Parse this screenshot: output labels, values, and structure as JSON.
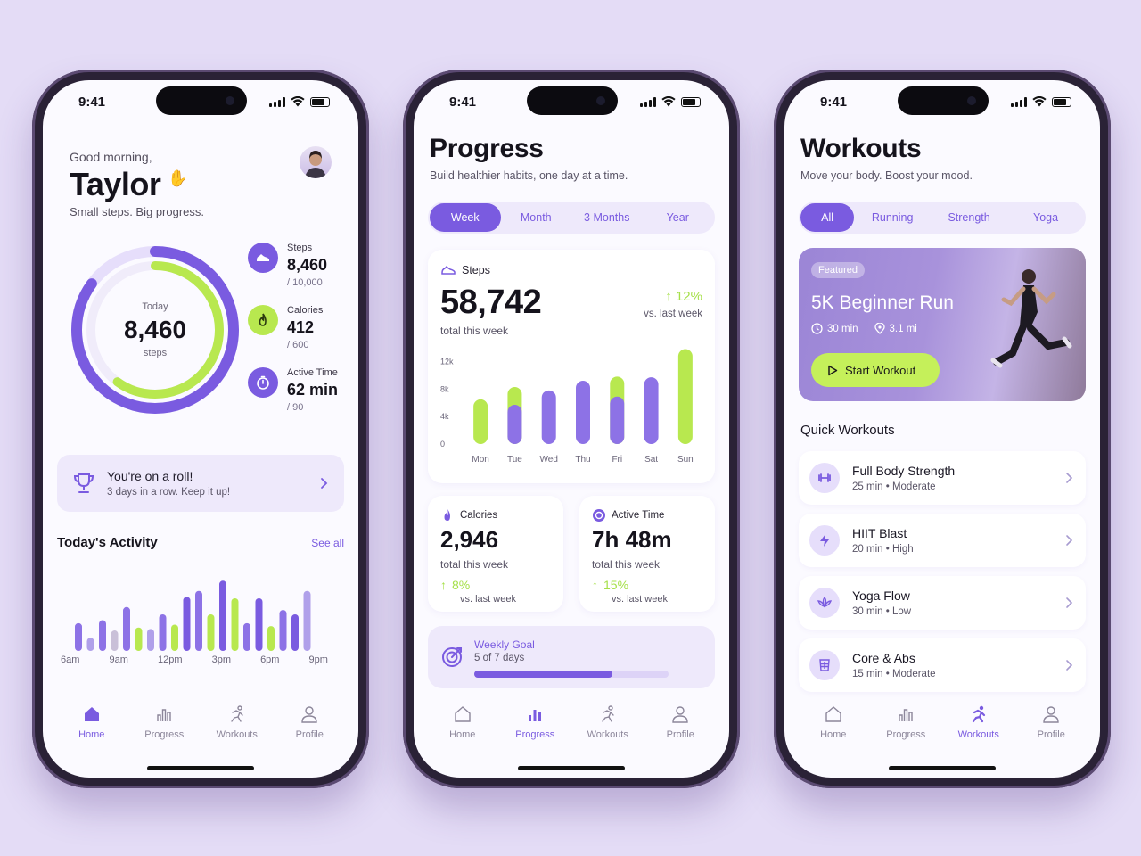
{
  "status": {
    "time": "9:41"
  },
  "tabs": [
    "Home",
    "Progress",
    "Workouts",
    "Profile"
  ],
  "home": {
    "greeting": "Good morning,",
    "name": "Taylor",
    "tagline": "Small steps. Big progress.",
    "ring": {
      "label": "Today",
      "value": "8,460",
      "unit": "steps",
      "outer_fraction": 0.85,
      "inner_fraction": 0.6
    },
    "metrics": [
      {
        "label": "Steps",
        "value": "8,460",
        "goal": "/ 10,000",
        "icon": "shoe-icon",
        "color": "#7a5be0"
      },
      {
        "label": "Calories",
        "value": "412",
        "goal": "/ 600",
        "icon": "flame-icon",
        "color": "#b8e84f"
      },
      {
        "label": "Active Time",
        "value": "62 min",
        "goal": "/ 90",
        "icon": "timer-icon",
        "color": "#7a5be0"
      }
    ],
    "streak": {
      "title": "You're on a roll!",
      "subtitle": "3 days in a row. Keep it up!"
    },
    "activity": {
      "title": "Today's Activity",
      "see_all": "See all",
      "x_labels": [
        "6am",
        "9am",
        "12pm",
        "3pm",
        "6pm",
        "9pm"
      ]
    }
  },
  "progress": {
    "title": "Progress",
    "subtitle": "Build healthier habits, one day at a time.",
    "segments": [
      "Week",
      "Month",
      "3 Months",
      "Year"
    ],
    "steps_card": {
      "label": "Steps",
      "value": "58,742",
      "sub": "total this week",
      "pct": "12%",
      "vs": "vs. last week"
    },
    "calories": {
      "label": "Calories",
      "value": "2,946",
      "sub": "total this week",
      "pct": "8%",
      "vs": "vs. last week"
    },
    "active": {
      "label": "Active Time",
      "value": "7h 48m",
      "sub": "total this week",
      "pct": "15%",
      "vs": "vs. last week"
    },
    "goal": {
      "label": "Weekly Goal",
      "sub": "5 of 7 days",
      "fraction": 0.71
    }
  },
  "workouts": {
    "title": "Workouts",
    "subtitle": "Move your body. Boost your mood.",
    "chips": [
      "All",
      "Running",
      "Strength",
      "Yoga"
    ],
    "featured": {
      "badge": "Featured",
      "title": "5K Beginner Run",
      "duration": "30 min",
      "distance": "3.1 mi",
      "button": "Start Workout"
    },
    "quick_title": "Quick Workouts",
    "quick": [
      {
        "name": "Full Body Strength",
        "duration": "25 min",
        "level": "Moderate",
        "icon": "dumbbell-icon"
      },
      {
        "name": "HIIT Blast",
        "duration": "20 min",
        "level": "High",
        "icon": "lightning-icon"
      },
      {
        "name": "Yoga Flow",
        "duration": "30 min",
        "level": "Low",
        "icon": "lotus-icon"
      },
      {
        "name": "Core & Abs",
        "duration": "15 min",
        "level": "Moderate",
        "icon": "abs-icon"
      }
    ]
  },
  "chart_data": [
    {
      "type": "bar",
      "categories": [
        "Mon",
        "Tue",
        "Wed",
        "Thu",
        "Fri",
        "Sat",
        "Sun"
      ],
      "series": [
        {
          "values": [
            6.5,
            8.3,
            7.8,
            9.2,
            9.8,
            9.7,
            13.8
          ]
        },
        {
          "values": [
            0,
            5.7,
            0,
            0,
            6.9,
            0,
            0
          ]
        }
      ],
      "yticks": [
        "0",
        "4k",
        "8k",
        "12k"
      ],
      "ylim": [
        0,
        14
      ]
    },
    {
      "type": "bar",
      "x_labels": [
        "6am",
        "9am",
        "12pm",
        "3pm",
        "6pm",
        "9pm"
      ],
      "values": [
        0.38,
        0.18,
        0.42,
        0.28,
        0.6,
        0.32,
        0.3,
        0.5,
        0.36,
        0.74,
        0.82,
        0.5,
        0.96,
        0.72,
        0.38,
        0.72,
        0.34,
        0.56,
        0.5,
        0.82
      ]
    }
  ]
}
